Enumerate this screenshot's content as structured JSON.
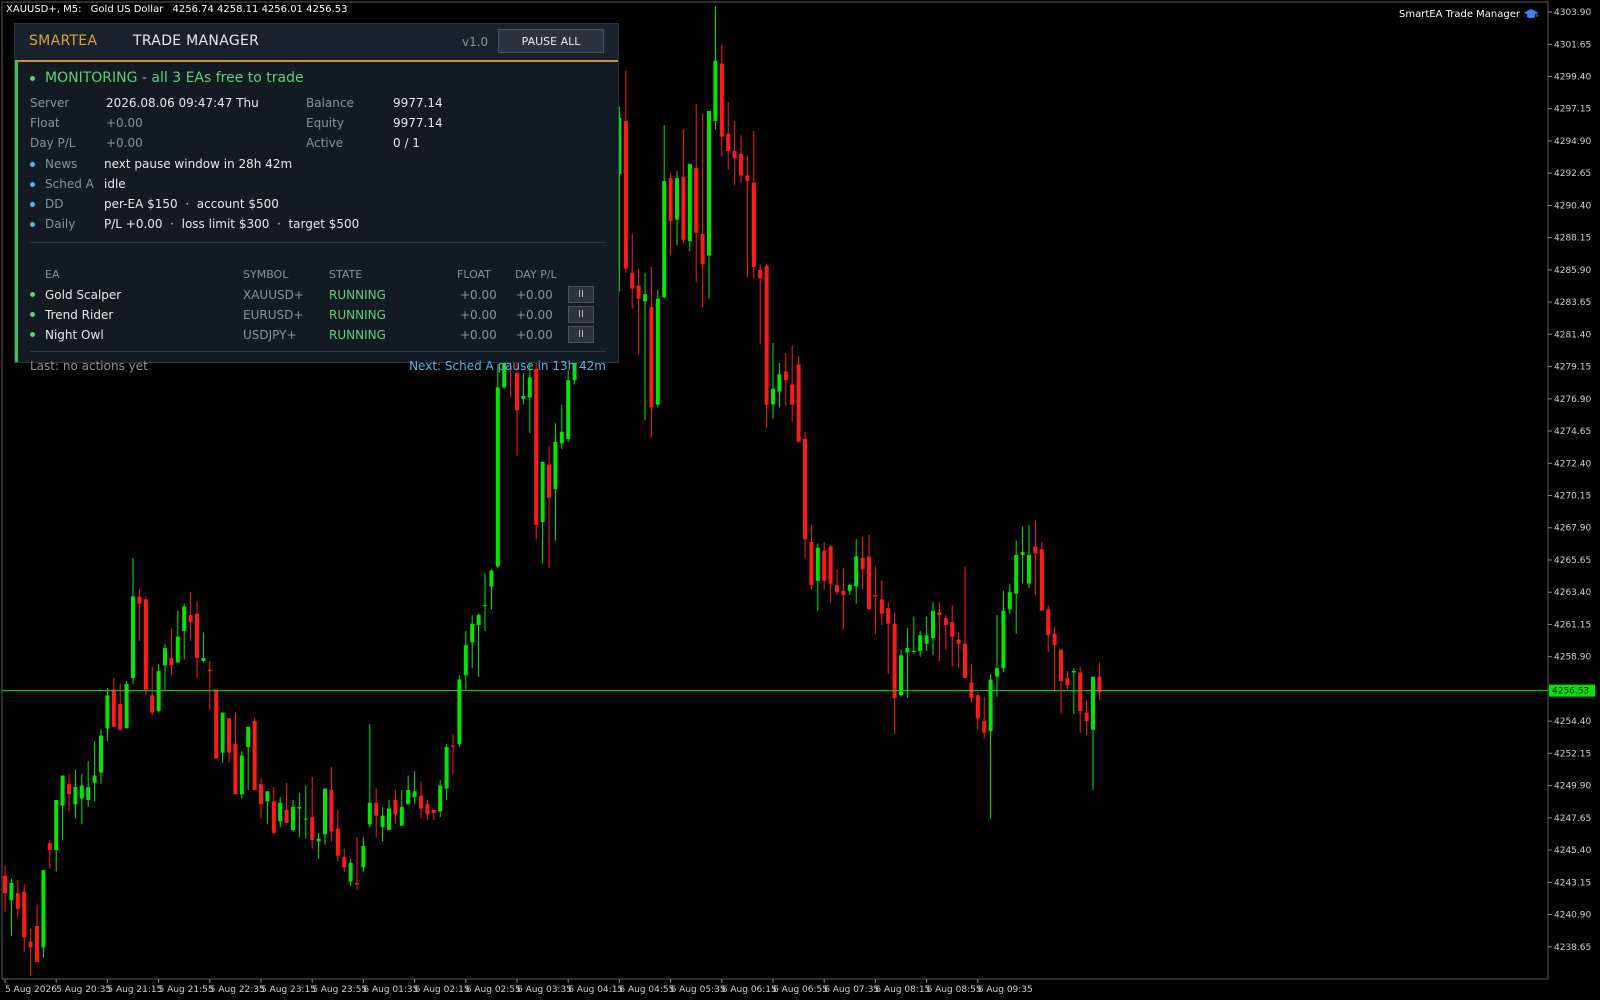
{
  "chart_header": {
    "symbol": "XAUUSD+, M5:",
    "description": "Gold US Dollar",
    "ohlc": "4256.74 4258.11 4256.01 4256.53"
  },
  "ea_label": "SmartEA Trade Manager",
  "current_price": "4256.53",
  "colors": {
    "bull": "#00e600",
    "bear": "#ff1a1a",
    "accent": "#e0a23a",
    "status_ok": "#5fd07a",
    "info": "#5ab4e8"
  },
  "chart_data": {
    "type": "candlestick",
    "title": "",
    "xlabel": "",
    "ylabel": "",
    "ylim": [
      4236.4,
      4304.6
    ],
    "price_ticks": [
      "4303.90",
      "4301.65",
      "4299.40",
      "4297.15",
      "4294.90",
      "4292.65",
      "4290.40",
      "4288.15",
      "4285.90",
      "4283.65",
      "4281.40",
      "4279.15",
      "4276.90",
      "4274.65",
      "4272.40",
      "4270.15",
      "4267.90",
      "4265.65",
      "4263.40",
      "4261.15",
      "4258.90",
      "4256.65",
      "4254.40",
      "4252.15",
      "4249.90",
      "4247.65",
      "4245.40",
      "4243.15",
      "4240.90",
      "4238.65"
    ],
    "time_ticks": [
      "5 Aug 2026",
      "5 Aug 20:35",
      "5 Aug 21:15",
      "5 Aug 21:55",
      "5 Aug 22:35",
      "5 Aug 23:15",
      "5 Aug 23:55",
      "6 Aug 01:35",
      "6 Aug 02:15",
      "6 Aug 02:55",
      "6 Aug 03:35",
      "6 Aug 04:15",
      "6 Aug 04:55",
      "6 Aug 05:35",
      "6 Aug 06:15",
      "6 Aug 06:55",
      "6 Aug 07:35",
      "6 Aug 08:15",
      "6 Aug 08:55",
      "6 Aug 09:35"
    ],
    "bars_per_tick": 8,
    "candles": [
      [
        4243.6,
        4244.3,
        4241.1,
        4242.4
      ],
      [
        4241.9,
        4243.4,
        4239.4,
        4243.1
      ],
      [
        4242.4,
        4243.3,
        4240.7,
        4241.3
      ],
      [
        4242.5,
        4243.0,
        4238.3,
        4239.3
      ],
      [
        4239.0,
        4239.9,
        4236.6,
        4238.6
      ],
      [
        4240.1,
        4241.6,
        4237.6,
        4237.6
      ],
      [
        4238.6,
        4244.0,
        4237.9,
        4244.0
      ],
      [
        4245.9,
        4246.1,
        4244.1,
        4245.4
      ],
      [
        4245.4,
        4248.9,
        4243.9,
        4248.9
      ],
      [
        4248.5,
        4250.6,
        4246.1,
        4250.6
      ],
      [
        4250.0,
        4250.7,
        4248.1,
        4249.3
      ],
      [
        4248.6,
        4251.0,
        4247.6,
        4249.8
      ],
      [
        4249.0,
        4250.7,
        4247.2,
        4249.9
      ],
      [
        4248.9,
        4251.6,
        4248.4,
        4249.8
      ],
      [
        4250.1,
        4253.0,
        4248.8,
        4250.6
      ],
      [
        4250.8,
        4253.8,
        4250.0,
        4253.4
      ],
      [
        4253.9,
        4256.7,
        4253.0,
        4256.2
      ],
      [
        4256.6,
        4257.4,
        4254.0,
        4254.0
      ],
      [
        4255.6,
        4257.0,
        4253.8,
        4253.8
      ],
      [
        4253.9,
        4257.2,
        4253.9,
        4257.0
      ],
      [
        4257.4,
        4265.8,
        4257.0,
        4263.1
      ],
      [
        4263.1,
        4263.6,
        4260.0,
        4262.6
      ],
      [
        4262.9,
        4263.1,
        4256.2,
        4256.6
      ],
      [
        4256.2,
        4258.2,
        4254.8,
        4255.0
      ],
      [
        4255.1,
        4258.4,
        4255.0,
        4257.9
      ],
      [
        4258.3,
        4259.8,
        4256.5,
        4259.5
      ],
      [
        4258.8,
        4260.9,
        4257.6,
        4258.3
      ],
      [
        4258.5,
        4262.1,
        4258.5,
        4260.3
      ],
      [
        4260.7,
        4262.6,
        4258.7,
        4262.4
      ],
      [
        4261.8,
        4263.4,
        4260.0,
        4261.3
      ],
      [
        4261.9,
        4262.8,
        4257.4,
        4258.8
      ],
      [
        4258.6,
        4260.6,
        4258.5,
        4258.8
      ],
      [
        4258.0,
        4258.6,
        4255.2,
        4257.9
      ],
      [
        4256.6,
        4256.6,
        4251.8,
        4251.8
      ],
      [
        4252.2,
        4255.0,
        4251.5,
        4255.0
      ],
      [
        4254.6,
        4254.6,
        4251.5,
        4252.2
      ],
      [
        4252.8,
        4255.0,
        4249.3,
        4249.3
      ],
      [
        4249.3,
        4252.3,
        4249.0,
        4252.0
      ],
      [
        4252.6,
        4254.0,
        4249.6,
        4254.0
      ],
      [
        4254.4,
        4254.6,
        4249.6,
        4249.6
      ],
      [
        4250.0,
        4250.4,
        4247.6,
        4248.6
      ],
      [
        4248.8,
        4249.5,
        4247.2,
        4249.5
      ],
      [
        4248.8,
        4249.8,
        4246.5,
        4246.6
      ],
      [
        4247.4,
        4249.1,
        4247.0,
        4248.7
      ],
      [
        4248.2,
        4250.1,
        4247.3,
        4247.3
      ],
      [
        4246.8,
        4248.9,
        4246.7,
        4248.4
      ],
      [
        4248.3,
        4249.4,
        4246.3,
        4248.4
      ],
      [
        4247.6,
        4249.9,
        4246.2,
        4247.6
      ],
      [
        4247.7,
        4250.5,
        4245.5,
        4246.1
      ],
      [
        4246.0,
        4246.6,
        4244.8,
        4246.2
      ],
      [
        4246.5,
        4249.7,
        4245.8,
        4249.7
      ],
      [
        4249.6,
        4251.2,
        4246.0,
        4246.7
      ],
      [
        4246.9,
        4248.2,
        4244.6,
        4245.0
      ],
      [
        4244.9,
        4245.5,
        4243.9,
        4244.2
      ],
      [
        4243.2,
        4244.8,
        4242.9,
        4244.5
      ],
      [
        4243.1,
        4246.3,
        4242.6,
        4243.0
      ],
      [
        4244.2,
        4246.3,
        4243.9,
        4245.7
      ],
      [
        4247.2,
        4254.2,
        4247.0,
        4248.7
      ],
      [
        4248.7,
        4249.7,
        4246.3,
        4247.8
      ],
      [
        4247.0,
        4248.4,
        4246.0,
        4247.8
      ],
      [
        4246.8,
        4248.9,
        4246.8,
        4248.3
      ],
      [
        4248.9,
        4249.6,
        4247.2,
        4247.9
      ],
      [
        4247.1,
        4249.6,
        4247.1,
        4248.4
      ],
      [
        4248.6,
        4250.6,
        4248.6,
        4249.6
      ],
      [
        4249.1,
        4250.9,
        4248.6,
        4249.5
      ],
      [
        4249.2,
        4250.2,
        4247.6,
        4248.3
      ],
      [
        4248.6,
        4248.9,
        4247.5,
        4247.9
      ],
      [
        4248.2,
        4248.2,
        4247.5,
        4248.0
      ],
      [
        4248.1,
        4250.3,
        4247.7,
        4249.9
      ],
      [
        4249.7,
        4252.8,
        4248.9,
        4252.6
      ],
      [
        4252.7,
        4253.5,
        4250.7,
        4252.6
      ],
      [
        4252.8,
        4257.6,
        4252.6,
        4257.3
      ],
      [
        4257.6,
        4260.7,
        4256.6,
        4259.7
      ],
      [
        4259.9,
        4261.8,
        4258.1,
        4261.2
      ],
      [
        4261.1,
        4261.9,
        4257.5,
        4261.8
      ],
      [
        4262.5,
        4264.7,
        4260.7,
        4262.5
      ],
      [
        4263.8,
        4265.0,
        4262.2,
        4264.9
      ],
      [
        4265.2,
        4279.3,
        4265.1,
        4277.7
      ],
      [
        4277.7,
        4281.6,
        4277.6,
        4279.6
      ],
      [
        4279.9,
        4282.4,
        4277.0,
        4279.4
      ],
      [
        4278.7,
        4279.8,
        4272.9,
        4276.1
      ],
      [
        4276.9,
        4278.7,
        4276.5,
        4277.1
      ],
      [
        4277.0,
        4281.0,
        4274.5,
        4278.4
      ],
      [
        4279.0,
        4279.4,
        4267.1,
        4268.1
      ],
      [
        4268.3,
        4272.5,
        4265.4,
        4272.5
      ],
      [
        4272.3,
        4273.6,
        4265.1,
        4270.0
      ],
      [
        4270.6,
        4275.2,
        4267.0,
        4273.9
      ],
      [
        4273.8,
        4276.5,
        4273.4,
        4274.6
      ],
      [
        4274.1,
        4278.9,
        4273.9,
        4278.2
      ],
      [
        4278.2,
        4286.6,
        4277.9,
        4286.1
      ],
      [
        4286.1,
        4289.2,
        4285.9,
        4286.5
      ],
      [
        4285.3,
        4287.7,
        4284.8,
        4286.2
      ],
      [
        4286.3,
        4296.8,
        4285.8,
        4296.6
      ],
      [
        4296.2,
        4298.0,
        4288.5,
        4288.6
      ],
      [
        4287.3,
        4294.9,
        4287.1,
        4294.3
      ],
      [
        4295.4,
        4296.7,
        4290.1,
        4292.6
      ],
      [
        4292.6,
        4297.3,
        4284.4,
        4296.5
      ],
      [
        4296.3,
        4299.8,
        4285.7,
        4286.0
      ],
      [
        4285.7,
        4288.4,
        4283.2,
        4284.6
      ],
      [
        4284.8,
        4286.0,
        4280.0,
        4283.9
      ],
      [
        4283.7,
        4285.7,
        4275.4,
        4284.2
      ],
      [
        4283.3,
        4286.1,
        4274.2,
        4276.3
      ],
      [
        4276.5,
        4284.5,
        4276.3,
        4283.9
      ],
      [
        4284.0,
        4296.0,
        4283.9,
        4292.1
      ],
      [
        4292.3,
        4292.6,
        4286.9,
        4289.3
      ],
      [
        4289.4,
        4292.8,
        4287.6,
        4292.3
      ],
      [
        4292.4,
        4295.7,
        4287.8,
        4288.0
      ],
      [
        4287.9,
        4293.3,
        4287.2,
        4293.3
      ],
      [
        4293.0,
        4297.5,
        4285.0,
        4288.5
      ],
      [
        4288.4,
        4296.8,
        4283.3,
        4286.3
      ],
      [
        4286.9,
        4296.9,
        4283.9,
        4297.0
      ],
      [
        4296.3,
        4304.3,
        4295.7,
        4300.5
      ],
      [
        4300.3,
        4301.6,
        4293.8,
        4295.2
      ],
      [
        4295.4,
        4297.6,
        4292.9,
        4294.2
      ],
      [
        4294.2,
        4296.3,
        4291.8,
        4293.7
      ],
      [
        4294.0,
        4295.3,
        4292.0,
        4292.5
      ],
      [
        4292.5,
        4293.9,
        4285.4,
        4292.1
      ],
      [
        4292.0,
        4295.6,
        4285.3,
        4286.1
      ],
      [
        4285.9,
        4286.3,
        4280.7,
        4285.3
      ],
      [
        4286.2,
        4286.3,
        4274.9,
        4276.5
      ],
      [
        4276.5,
        4280.8,
        4275.5,
        4277.6
      ],
      [
        4277.4,
        4279.4,
        4276.3,
        4278.6
      ],
      [
        4278.8,
        4280.1,
        4276.4,
        4278.2
      ],
      [
        4277.9,
        4280.6,
        4275.3,
        4276.5
      ],
      [
        4279.3,
        4279.9,
        4273.9,
        4273.9
      ],
      [
        4274.1,
        4274.6,
        4265.8,
        4267.1
      ],
      [
        4266.9,
        4268.1,
        4263.6,
        4263.9
      ],
      [
        4264.2,
        4266.8,
        4262.1,
        4266.5
      ],
      [
        4266.3,
        4266.9,
        4263.6,
        4264.2
      ],
      [
        4266.6,
        4266.7,
        4262.7,
        4264.0
      ],
      [
        4263.9,
        4265.0,
        4263.2,
        4263.4
      ],
      [
        4263.5,
        4265.1,
        4260.8,
        4263.2
      ],
      [
        4263.5,
        4264.0,
        4263.2,
        4263.9
      ],
      [
        4263.8,
        4267.1,
        4262.6,
        4265.9
      ],
      [
        4265.8,
        4267.3,
        4263.6,
        4265.0
      ],
      [
        4265.9,
        4267.4,
        4263.4,
        4262.2
      ],
      [
        4263.2,
        4265.2,
        4260.5,
        4263.1
      ],
      [
        4262.9,
        4264.2,
        4261.1,
        4261.9
      ],
      [
        4262.3,
        4262.7,
        4257.7,
        4261.2
      ],
      [
        4261.2,
        4262.0,
        4253.5,
        4256.0
      ],
      [
        4256.2,
        4259.4,
        4256.1,
        4259.0
      ],
      [
        4259.2,
        4260.9,
        4256.0,
        4259.5
      ],
      [
        4259.3,
        4261.7,
        4259.1,
        4259.3
      ],
      [
        4259.3,
        4260.7,
        4258.9,
        4260.4
      ],
      [
        4259.8,
        4261.7,
        4259.3,
        4260.4
      ],
      [
        4260.2,
        4262.7,
        4259.0,
        4262.1
      ],
      [
        4262.0,
        4262.7,
        4258.6,
        4261.8
      ],
      [
        4261.6,
        4261.8,
        4259.4,
        4261.1
      ],
      [
        4261.3,
        4262.5,
        4258.2,
        4260.3
      ],
      [
        4260.1,
        4260.6,
        4258.1,
        4259.8
      ],
      [
        4259.8,
        4265.2,
        4258.4,
        4257.4
      ],
      [
        4257.1,
        4258.4,
        4255.7,
        4256.0
      ],
      [
        4256.2,
        4256.4,
        4253.8,
        4254.6
      ],
      [
        4254.4,
        4256.1,
        4253.2,
        4253.6
      ],
      [
        4253.7,
        4257.7,
        4247.6,
        4257.3
      ],
      [
        4257.5,
        4261.8,
        4256.1,
        4258.1
      ],
      [
        4258.1,
        4263.5,
        4257.8,
        4262.1
      ],
      [
        4262.2,
        4264.0,
        4261.9,
        4263.4
      ],
      [
        4263.3,
        4267.0,
        4260.5,
        4266.0
      ],
      [
        4266.0,
        4268.0,
        4264.0,
        4266.2
      ],
      [
        4264.0,
        4268.1,
        4263.7,
        4266.0
      ],
      [
        4266.6,
        4268.4,
        4263.2,
        4266.1
      ],
      [
        4266.4,
        4266.9,
        4262.4,
        4262.1
      ],
      [
        4262.2,
        4262.5,
        4259.2,
        4260.4
      ],
      [
        4260.5,
        4261.0,
        4256.4,
        4259.7
      ],
      [
        4259.4,
        4259.4,
        4254.9,
        4257.2
      ],
      [
        4257.4,
        4257.9,
        4256.6,
        4256.9
      ],
      [
        4257.8,
        4258.1,
        4254.9,
        4257.9
      ],
      [
        4257.8,
        4258.2,
        4253.6,
        4255.1
      ],
      [
        4255.0,
        4255.9,
        4253.4,
        4254.4
      ],
      [
        4253.8,
        4257.0,
        4249.6,
        4257.5
      ],
      [
        4257.5,
        4258.5,
        4255.9,
        4256.4
      ]
    ]
  },
  "panel": {
    "brand": "SMARTEA",
    "title": "TRADE MANAGER",
    "version": "v1.0",
    "pause_all_label": "PAUSE ALL",
    "status": "MONITORING - all 3 EAs free to trade",
    "info": {
      "server_label": "Server",
      "server_value": "2026.08.06 09:47:47 Thu",
      "float_label": "Float",
      "float_value": "+0.00",
      "daypl_label": "Day P/L",
      "daypl_value": "+0.00",
      "balance_label": "Balance",
      "balance_value": "9977.14",
      "equity_label": "Equity",
      "equity_value": "9977.14",
      "active_label": "Active",
      "active_value": "0 / 1"
    },
    "stats": [
      {
        "label": "News",
        "value": "next pause window in 28h 42m"
      },
      {
        "label": "Sched A",
        "value": "idle"
      },
      {
        "label": "DD",
        "value": "per-EA $150  ·  account $500"
      },
      {
        "label": "Daily",
        "value": "P/L +0.00  ·  loss limit $300  ·  target $500"
      }
    ],
    "table_headers": {
      "ea": "EA",
      "symbol": "SYMBOL",
      "state": "STATE",
      "float": "FLOAT",
      "day_pl": "DAY P/L"
    },
    "eas": [
      {
        "name": "Gold Scalper",
        "symbol": "XAUUSD+",
        "state": "RUNNING",
        "float": "+0.00",
        "day_pl": "+0.00",
        "btn": "II"
      },
      {
        "name": "Trend Rider",
        "symbol": "EURUSD+",
        "state": "RUNNING",
        "float": "+0.00",
        "day_pl": "+0.00",
        "btn": "II"
      },
      {
        "name": "Night Owl",
        "symbol": "USDJPY+",
        "state": "RUNNING",
        "float": "+0.00",
        "day_pl": "+0.00",
        "btn": "II"
      }
    ],
    "footer": {
      "last_label": "Last:",
      "last_value": "no actions yet",
      "next_label": "Next:",
      "next_value": "Sched A pause in 13h 42m"
    }
  }
}
